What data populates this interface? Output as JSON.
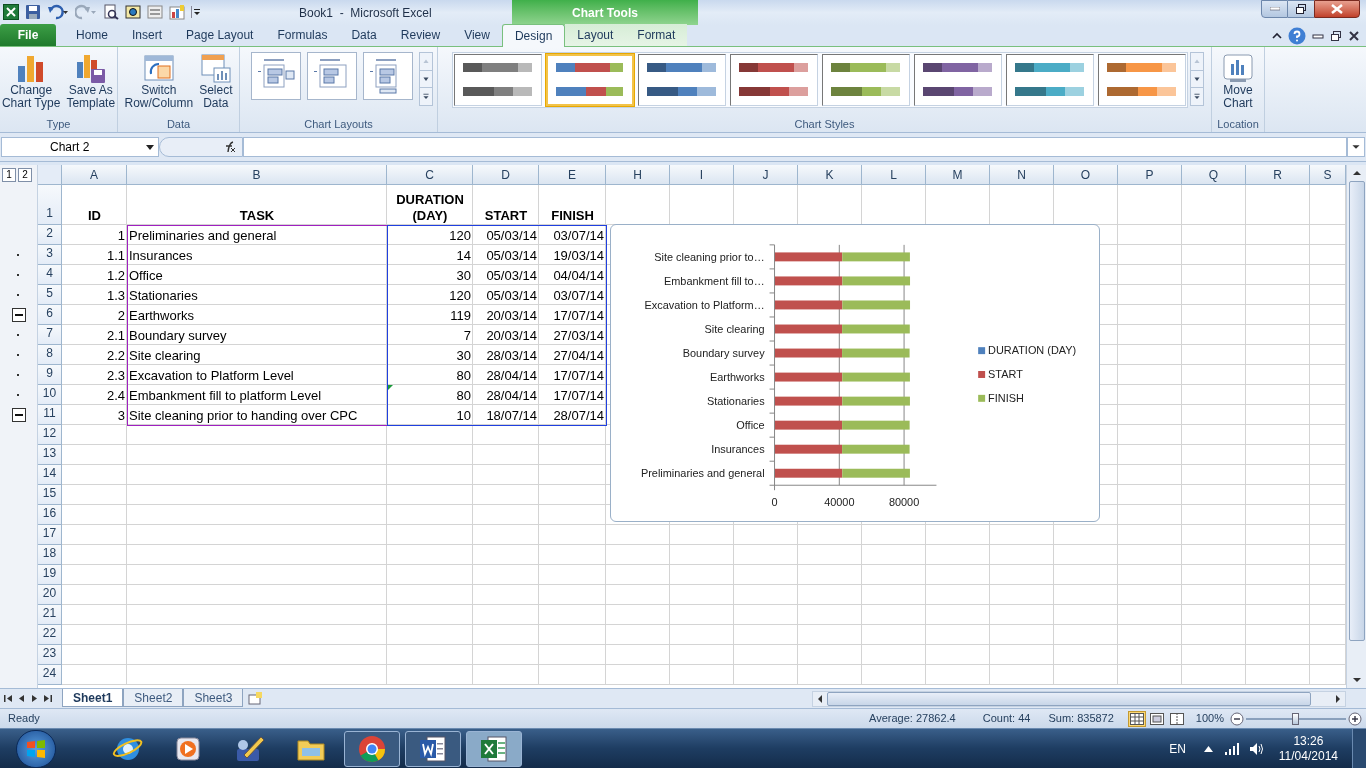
{
  "window": {
    "title": "Book1  -  Microsoft Excel",
    "context_tab": "Chart Tools"
  },
  "ribbon_tabs": [
    {
      "label": "File",
      "kind": "file",
      "selected": false
    },
    {
      "label": "Home",
      "selected": false
    },
    {
      "label": "Insert",
      "selected": false
    },
    {
      "label": "Page Layout",
      "selected": false
    },
    {
      "label": "Formulas",
      "selected": false
    },
    {
      "label": "Data",
      "selected": false
    },
    {
      "label": "Review",
      "selected": false
    },
    {
      "label": "View",
      "selected": false
    },
    {
      "label": "Design",
      "kind": "context",
      "selected": true
    },
    {
      "label": "Layout",
      "kind": "context",
      "selected": false
    },
    {
      "label": "Format",
      "kind": "context",
      "selected": false
    }
  ],
  "ribbon_groups": [
    {
      "label": "Type",
      "kind": "buttons",
      "buttons": [
        {
          "kind": "change_type",
          "lines": [
            "Change",
            "Chart Type"
          ]
        },
        {
          "kind": "save_template",
          "lines": [
            "Save As",
            "Template"
          ]
        }
      ]
    },
    {
      "label": "Data",
      "kind": "buttons",
      "buttons": [
        {
          "kind": "switch",
          "lines": [
            "Switch",
            "Row/Column"
          ]
        },
        {
          "kind": "select_data",
          "lines": [
            "Select",
            "Data"
          ]
        }
      ]
    },
    {
      "label": "Chart Layouts",
      "kind": "layouts"
    },
    {
      "label": "Chart Styles",
      "kind": "styles"
    },
    {
      "label": "Location",
      "kind": "buttons",
      "buttons": [
        {
          "kind": "move",
          "lines": [
            "Move",
            "Chart"
          ]
        }
      ]
    }
  ],
  "chart_styles": [
    {
      "kind": "mono",
      "color": "#7f7f7f",
      "selected": false
    },
    {
      "kind": "multi",
      "selected": true
    },
    {
      "kind": "mono",
      "color": "#4f81bd",
      "selected": false
    },
    {
      "kind": "mono",
      "color": "#c0504d",
      "selected": false
    },
    {
      "kind": "mono",
      "color": "#9bbb59",
      "selected": false
    },
    {
      "kind": "mono",
      "color": "#8064a2",
      "selected": false
    },
    {
      "kind": "mono",
      "color": "#4bacc6",
      "selected": false
    },
    {
      "kind": "mono",
      "color": "#f79646",
      "selected": false
    }
  ],
  "name_box": "Chart 2",
  "outline_levels": [
    "1",
    "2"
  ],
  "columns": [
    "A",
    "B",
    "C",
    "D",
    "E",
    "H",
    "I",
    "J",
    "K",
    "L",
    "M",
    "N",
    "O",
    "P",
    "Q",
    "R",
    "S"
  ],
  "rows": [
    {
      "number": "1",
      "kind": "plain",
      "cells": [
        "ID",
        "TASK",
        "DURATION (DAY)",
        "START",
        "FINISH"
      ]
    },
    {
      "number": "2",
      "kind": "plain",
      "cells": [
        "1",
        "Preliminaries and general",
        "120",
        "05/03/14",
        "03/07/14"
      ]
    },
    {
      "number": "3",
      "kind": "detail",
      "cells": [
        "1.1",
        "Insurances",
        "14",
        "05/03/14",
        "19/03/14"
      ]
    },
    {
      "number": "4",
      "kind": "detail",
      "cells": [
        "1.2",
        "Office",
        "30",
        "05/03/14",
        "04/04/14"
      ]
    },
    {
      "number": "5",
      "kind": "detail",
      "cells": [
        "1.3",
        "Stationaries",
        "120",
        "05/03/14",
        "03/07/14"
      ]
    },
    {
      "number": "6",
      "kind": "summary",
      "cells": [
        "2",
        "Earthworks",
        "119",
        "20/03/14",
        "17/07/14"
      ]
    },
    {
      "number": "7",
      "kind": "detail",
      "cells": [
        "2.1",
        "Boundary survey",
        "7",
        "20/03/14",
        "27/03/14"
      ]
    },
    {
      "number": "8",
      "kind": "detail",
      "cells": [
        "2.2",
        "Site clearing",
        "30",
        "28/03/14",
        "27/04/14"
      ]
    },
    {
      "number": "9",
      "kind": "detail",
      "cells": [
        "2.3",
        "Excavation to Platform Level",
        "80",
        "28/04/14",
        "17/07/14"
      ]
    },
    {
      "number": "10",
      "kind": "detail",
      "cells": [
        "2.4",
        "Embankment fill to platform Level",
        "80",
        "28/04/14",
        "17/07/14"
      ]
    },
    {
      "number": "11",
      "kind": "summary",
      "cells": [
        "3",
        "Site cleaning prior to handing over CPC",
        "10",
        "18/07/14",
        "28/07/14"
      ]
    },
    {
      "number": "12",
      "kind": "plain"
    },
    {
      "number": "13",
      "kind": "plain"
    },
    {
      "number": "14",
      "kind": "plain"
    },
    {
      "number": "15",
      "kind": "plain"
    },
    {
      "number": "16",
      "kind": "plain"
    },
    {
      "number": "17",
      "kind": "plain"
    },
    {
      "number": "18",
      "kind": "plain"
    },
    {
      "number": "19",
      "kind": "plain"
    },
    {
      "number": "20",
      "kind": "plain"
    },
    {
      "number": "21",
      "kind": "plain"
    },
    {
      "number": "22",
      "kind": "plain"
    },
    {
      "number": "23",
      "kind": "plain"
    },
    {
      "number": "24",
      "kind": "plain"
    }
  ],
  "chart": {
    "chart_data": {
      "type": "bar",
      "orientation": "horizontal",
      "stacked": true,
      "categories": [
        "Site cleaning prior to…",
        "Embankment fill to…",
        "Excavation to Platform…",
        "Site clearing",
        "Boundary survey",
        "Earthworks",
        "Stationaries",
        "Office",
        "Insurances",
        "Preliminaries and general"
      ],
      "series": [
        {
          "name": "DURATION (DAY)",
          "color": "#4f81bd",
          "values": [
            10,
            80,
            80,
            30,
            7,
            119,
            120,
            30,
            14,
            120
          ]
        },
        {
          "name": "START",
          "color": "#c0504d",
          "values": [
            41800,
            41800,
            41800,
            41700,
            41700,
            41700,
            41700,
            41700,
            41700,
            41700
          ]
        },
        {
          "name": "FINISH",
          "color": "#9bbb59",
          "values": [
            41800,
            41800,
            41800,
            41800,
            41700,
            41800,
            41800,
            41700,
            41700,
            41800
          ]
        }
      ],
      "xlim": [
        0,
        100000
      ],
      "xticks": [
        0,
        40000,
        80000
      ],
      "legend": "right"
    }
  },
  "sheet_tabs": [
    {
      "label": "Sheet1",
      "selected": true
    },
    {
      "label": "Sheet2",
      "selected": false
    },
    {
      "label": "Sheet3",
      "selected": false
    }
  ],
  "status_bar": {
    "mode": "Ready",
    "average": "Average: 27862.4",
    "count": "Count: 44",
    "sum": "Sum: 835872",
    "views": [
      {
        "kind": "normal",
        "selected": true
      },
      {
        "kind": "page_layout",
        "selected": false
      },
      {
        "kind": "page_break",
        "selected": false
      }
    ],
    "zoom": "100%",
    "zoom_slider": {
      "level": 0.5
    }
  },
  "taskbar": {
    "apps": [
      {
        "kind": "ie",
        "open": false,
        "selected": false
      },
      {
        "kind": "media",
        "open": false,
        "selected": false
      },
      {
        "kind": "tool",
        "open": false,
        "selected": false
      },
      {
        "kind": "explorer",
        "open": false,
        "selected": false
      },
      {
        "kind": "chrome",
        "open": true,
        "selected": false
      },
      {
        "kind": "word",
        "open": true,
        "selected": false
      },
      {
        "kind": "excel",
        "open": true,
        "selected": true
      }
    ],
    "language": "EN",
    "time": "13:26",
    "date": "11/04/2014"
  }
}
